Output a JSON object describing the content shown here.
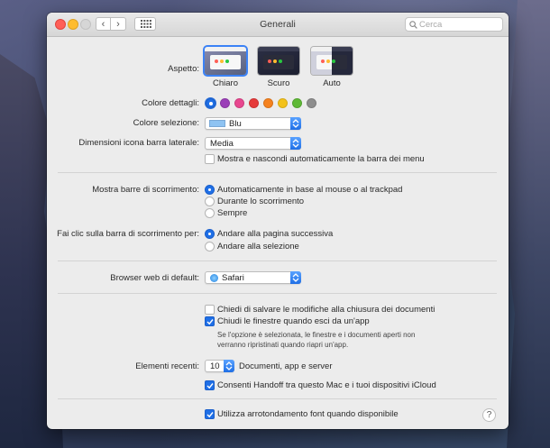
{
  "window": {
    "title": "Generali"
  },
  "toolbar": {
    "back_icon": "chevron-left-icon",
    "forward_icon": "chevron-right-icon",
    "grid_icon": "show-all-grid-icon"
  },
  "search": {
    "placeholder": "Cerca",
    "value": ""
  },
  "appearance": {
    "label": "Aspetto:",
    "options": [
      {
        "label": "Chiaro",
        "selected": true
      },
      {
        "label": "Scuro",
        "selected": false
      },
      {
        "label": "Auto",
        "selected": false
      }
    ]
  },
  "accent": {
    "label": "Colore dettagli:",
    "colors": [
      {
        "name": "blue",
        "hex": "#1f6fe6",
        "selected": true
      },
      {
        "name": "purple",
        "hex": "#9b3eb8",
        "selected": false
      },
      {
        "name": "pink",
        "hex": "#e8478f",
        "selected": false
      },
      {
        "name": "red",
        "hex": "#e63a3a",
        "selected": false
      },
      {
        "name": "orange",
        "hex": "#f5821f",
        "selected": false
      },
      {
        "name": "yellow",
        "hex": "#f3c21b",
        "selected": false
      },
      {
        "name": "green",
        "hex": "#5fb936",
        "selected": false
      },
      {
        "name": "graphite",
        "hex": "#8e8e8e",
        "selected": false
      }
    ]
  },
  "highlight": {
    "label": "Colore selezione:",
    "value": "Blu",
    "swatch": "#8ec3f2"
  },
  "sidebar_icon": {
    "label": "Dimensioni icona barra laterale:",
    "value": "Media"
  },
  "menu_bar": {
    "label": "Mostra e nascondi automaticamente la barra dei menu",
    "checked": false
  },
  "scrollbars": {
    "label": "Mostra barre di scorrimento:",
    "options": [
      {
        "label": "Automaticamente in base al mouse o al trackpad",
        "selected": true
      },
      {
        "label": "Durante lo scorrimento",
        "selected": false
      },
      {
        "label": "Sempre",
        "selected": false
      }
    ]
  },
  "scroll_click": {
    "label": "Fai clic sulla barra di scorrimento per:",
    "options": [
      {
        "label": "Andare alla pagina successiva",
        "selected": true
      },
      {
        "label": "Andare alla selezione",
        "selected": false
      }
    ]
  },
  "browser": {
    "label": "Browser web di default:",
    "value": "Safari",
    "icon": "safari-compass-icon"
  },
  "documents": {
    "ask_save": {
      "label": "Chiedi di salvare le modifiche alla chiusura dei documenti",
      "checked": false
    },
    "close_windows": {
      "label": "Chiudi le finestre quando esci da un'app",
      "checked": true
    },
    "note_line1": "Se l'opzione è selezionata, le finestre e i documenti aperti non",
    "note_line2": "verranno ripristinati quando riapri un'app."
  },
  "recent": {
    "label": "Elementi recenti:",
    "value": "10",
    "suffix": "Documenti, app e server"
  },
  "handoff": {
    "label": "Consenti Handoff tra questo Mac e i tuoi dispositivi iCloud",
    "checked": true
  },
  "font_smoothing": {
    "label": "Utilizza arrotondamento font quando disponibile",
    "checked": true
  },
  "help": {
    "label": "?"
  }
}
